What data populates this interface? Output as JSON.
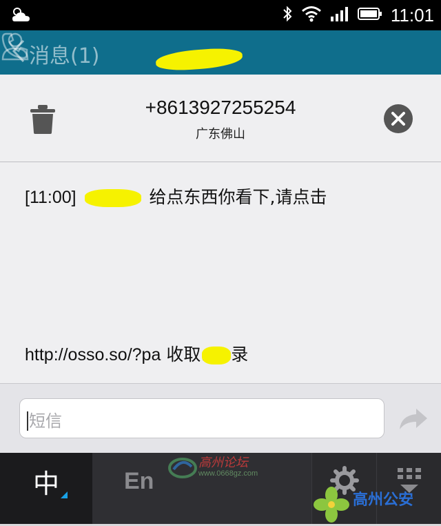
{
  "status_bar": {
    "time": "11:01"
  },
  "app_bar": {
    "back_label": "消息(1)"
  },
  "dialog": {
    "phone_number": "+8613927255254",
    "location": "广东佛山",
    "message_time": "[11:00]",
    "message_line1": "给点东西你看下,请点击",
    "message_link": "http://osso.so/?pa",
    "message_line2_cont": "收取.",
    "message_line2_end": "录"
  },
  "input": {
    "placeholder": "短信"
  },
  "keyboard": {
    "chinese_key": "中",
    "english_key": "En"
  },
  "watermarks": {
    "site_title": "高州论坛",
    "site_url": "www.0668gz.com",
    "corner_title": "高州公安"
  },
  "colors": {
    "app_bar": "#0f6e8c",
    "highlight": "#f6f200",
    "ime_accent": "#19a1e6"
  }
}
